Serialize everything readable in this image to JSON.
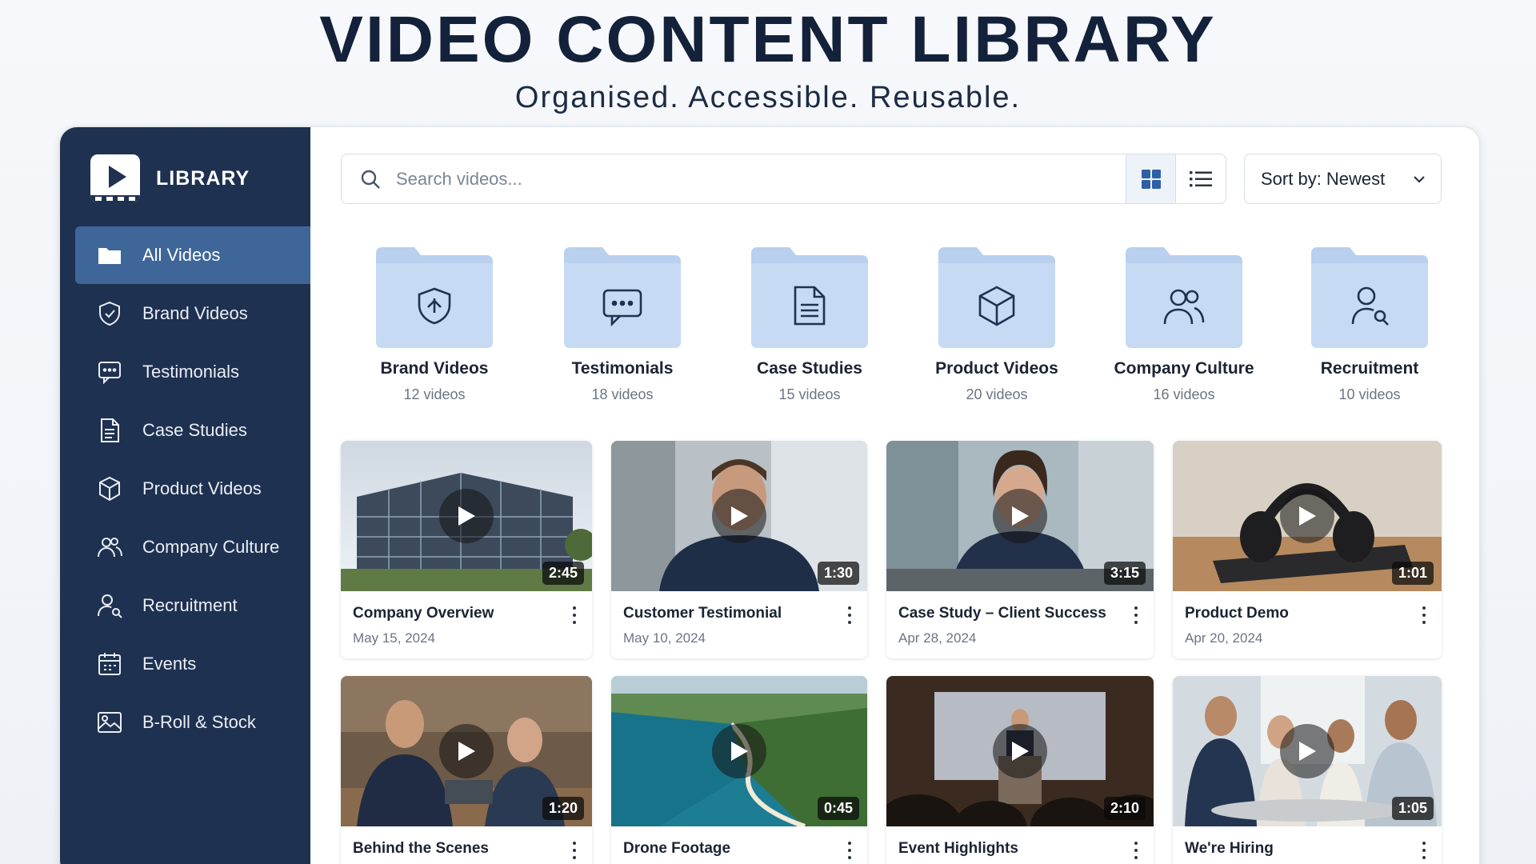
{
  "hero": {
    "title": "VIDEO CONTENT LIBRARY",
    "subtitle": "Organised. Accessible. Reusable."
  },
  "sidebar": {
    "brand": "LIBRARY",
    "items": [
      {
        "label": "All Videos",
        "icon": "folder-icon",
        "active": true
      },
      {
        "label": "Brand Videos",
        "icon": "shield-icon"
      },
      {
        "label": "Testimonials",
        "icon": "chat-icon"
      },
      {
        "label": "Case Studies",
        "icon": "document-icon"
      },
      {
        "label": "Product Videos",
        "icon": "box-icon"
      },
      {
        "label": "Company Culture",
        "icon": "people-icon"
      },
      {
        "label": "Recruitment",
        "icon": "person-search-icon"
      },
      {
        "label": "Events",
        "icon": "calendar-icon"
      },
      {
        "label": "B-Roll & Stock",
        "icon": "image-icon"
      }
    ]
  },
  "toolbar": {
    "search_placeholder": "Search videos...",
    "sort_label": "Sort by: Newest"
  },
  "folders": [
    {
      "name": "Brand Videos",
      "count": "12 videos",
      "icon": "shield-icon"
    },
    {
      "name": "Testimonials",
      "count": "18 videos",
      "icon": "chat-icon"
    },
    {
      "name": "Case Studies",
      "count": "15 videos",
      "icon": "document-icon"
    },
    {
      "name": "Product Videos",
      "count": "20 videos",
      "icon": "box-icon"
    },
    {
      "name": "Company Culture",
      "count": "16 videos",
      "icon": "people-icon"
    },
    {
      "name": "Recruitment",
      "count": "10 videos",
      "icon": "person-search-icon"
    }
  ],
  "videos": [
    {
      "title": "Company Overview",
      "date": "May 15, 2024",
      "duration": "2:45"
    },
    {
      "title": "Customer Testimonial",
      "date": "May 10, 2024",
      "duration": "1:30"
    },
    {
      "title": "Case Study – Client Success",
      "date": "Apr 28, 2024",
      "duration": "3:15"
    },
    {
      "title": "Product Demo",
      "date": "Apr 20, 2024",
      "duration": "1:01"
    },
    {
      "title": "Behind the Scenes",
      "date": "",
      "duration": "1:20"
    },
    {
      "title": "Drone Footage",
      "date": "",
      "duration": "0:45"
    },
    {
      "title": "Event Highlights",
      "date": "",
      "duration": "2:10"
    },
    {
      "title": "We're Hiring",
      "date": "",
      "duration": "1:05"
    }
  ],
  "colors": {
    "sidebar_bg": "#1f3150",
    "sidebar_active": "#3f6698",
    "folder_fill": "#b9d0ee",
    "title_text": "#14213a"
  }
}
